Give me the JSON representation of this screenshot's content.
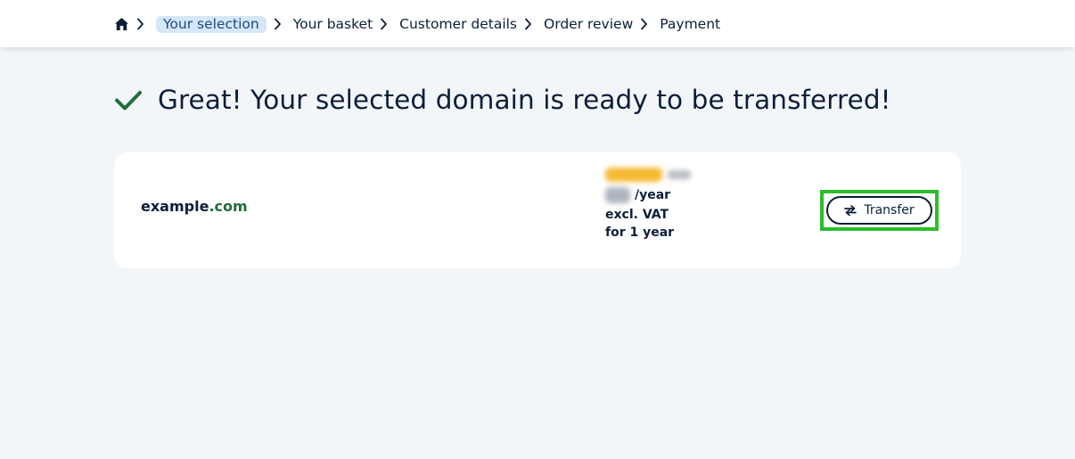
{
  "breadcrumb": {
    "home_icon": "home-icon",
    "items": [
      "Your selection",
      "Your basket",
      "Customer details",
      "Order review",
      "Payment"
    ],
    "active_index": 0
  },
  "heading": {
    "icon": "check-icon",
    "text": "Great! Your selected domain is ready to be transferred!"
  },
  "result": {
    "domain_name": "example",
    "domain_tld": ".com",
    "price_per": "/year",
    "vat_note": "excl. VAT",
    "period": "for 1 year",
    "button_label": "Transfer",
    "button_icon": "transfer-arrows-icon"
  },
  "colors": {
    "accent_green": "#1f6e38",
    "navy": "#0b1f3a",
    "active_crumb_bg": "#d6e7f7",
    "highlight": "#2bbd2b"
  }
}
